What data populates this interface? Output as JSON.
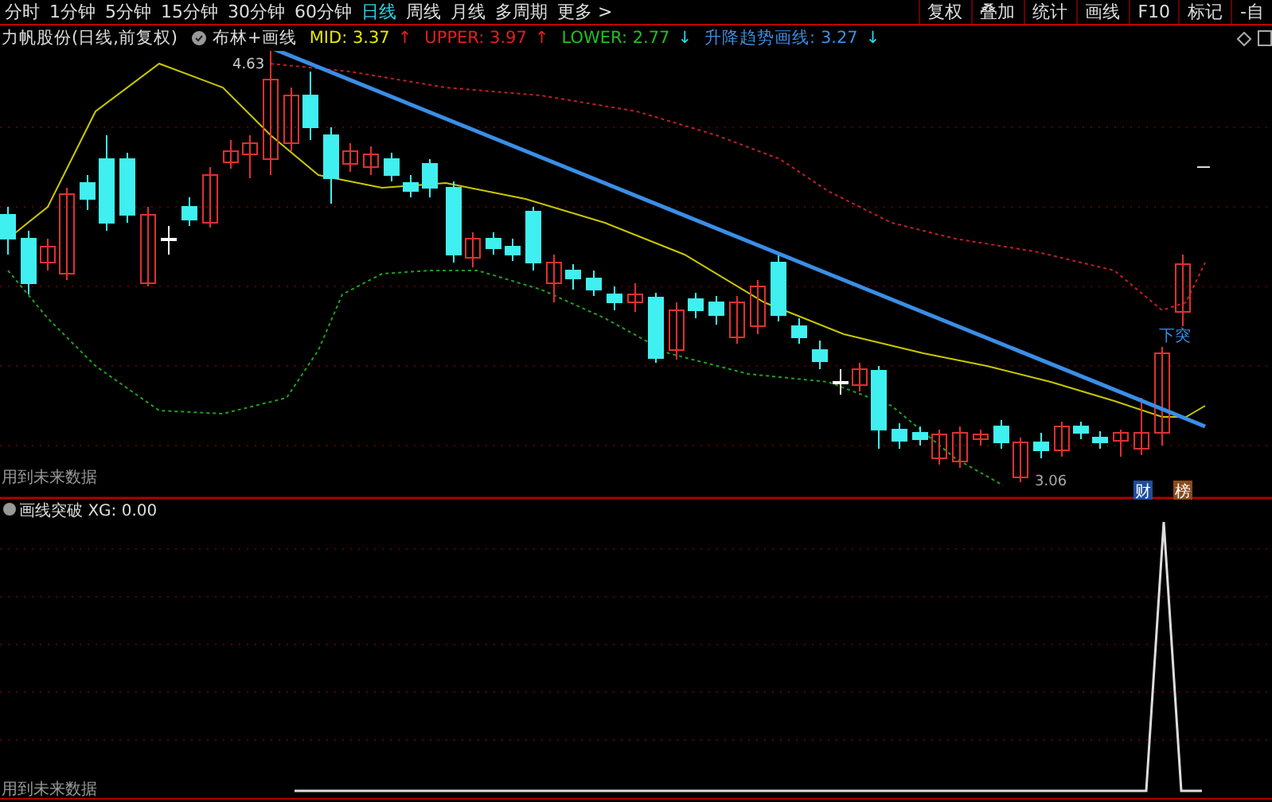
{
  "toolbar": {
    "periods": [
      {
        "label": "分时",
        "selected": false
      },
      {
        "label": "1分钟",
        "selected": false
      },
      {
        "label": "5分钟",
        "selected": false
      },
      {
        "label": "15分钟",
        "selected": false
      },
      {
        "label": "30分钟",
        "selected": false
      },
      {
        "label": "60分钟",
        "selected": false
      },
      {
        "label": "日线",
        "selected": true
      },
      {
        "label": "周线",
        "selected": false
      },
      {
        "label": "月线",
        "selected": false
      },
      {
        "label": "多周期",
        "selected": false
      },
      {
        "label": "更多 >",
        "selected": false
      }
    ],
    "buttons": [
      "复权",
      "叠加",
      "统计",
      "画线",
      "F10",
      "标记",
      "-自"
    ]
  },
  "legend": {
    "stock": "力帆股份(日线,前复权)",
    "indicator": "布林+画线",
    "values": [
      {
        "name": "MID:",
        "value": "3.37",
        "arrow": "↑",
        "rising": true,
        "color": "#e6e600"
      },
      {
        "name": "UPPER:",
        "value": "3.97",
        "arrow": "↑",
        "rising": true,
        "color": "#e02020"
      },
      {
        "name": "LOWER:",
        "value": "2.77",
        "arrow": "↓",
        "rising": false,
        "color": "#20c020"
      },
      {
        "name": "升降趋势画线:",
        "value": "3.27",
        "arrow": "↓",
        "rising": false,
        "color": "#3a8ee6"
      }
    ]
  },
  "main_chart": {
    "high_label": "4.63",
    "low_label": "3.06",
    "signal_label": "下突",
    "badges": [
      {
        "text": "财",
        "color": "#1f4e9a"
      },
      {
        "text": "榜",
        "color": "#8a4a1c"
      }
    ],
    "note": "用到未来数据"
  },
  "sub_pane": {
    "title": "画线突破",
    "reading": "XG: 0.00",
    "note": "用到未来数据"
  }
}
